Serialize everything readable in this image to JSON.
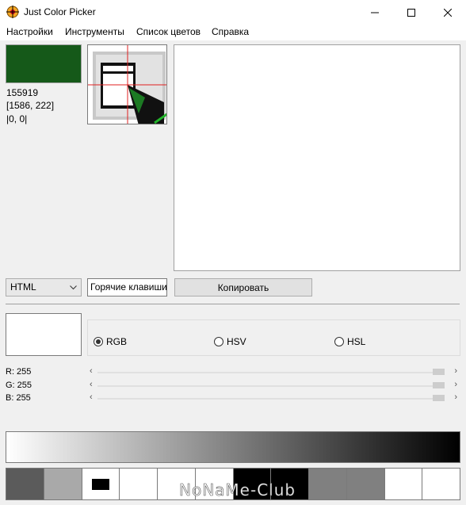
{
  "window": {
    "title": "Just Color Picker"
  },
  "icons": {
    "app": "app-crosshair-icon",
    "minimize": "minimize-icon",
    "maximize": "maximize-icon",
    "close": "close-icon",
    "dropdown": "chevron-down-icon"
  },
  "menu": [
    "Настройки",
    "Инструменты",
    "Список цветов",
    "Справка"
  ],
  "picked": {
    "color": "#155919",
    "code": "155919",
    "position": "[1586, 222]",
    "offset": "|0, 0|"
  },
  "controls": {
    "format": "HTML",
    "hotkeys": "Горячие клавиши",
    "copy": "Копировать"
  },
  "modes": {
    "options": [
      "RGB",
      "HSV",
      "HSL"
    ],
    "selected": "RGB"
  },
  "channels": [
    {
      "label": "R: 255",
      "value": 255
    },
    {
      "label": "G: 255",
      "value": 255
    },
    {
      "label": "B: 255",
      "value": 255
    }
  ],
  "palette_colors": [
    "#5b5b5b",
    "#a9a9a9",
    "#ffffff",
    "#ffffff",
    "#ffffff",
    "#ffffff",
    "#000000",
    "#000000",
    "#808080",
    "#808080",
    "#ffffff",
    "#ffffff"
  ],
  "watermark": "NoNaMe-Club"
}
